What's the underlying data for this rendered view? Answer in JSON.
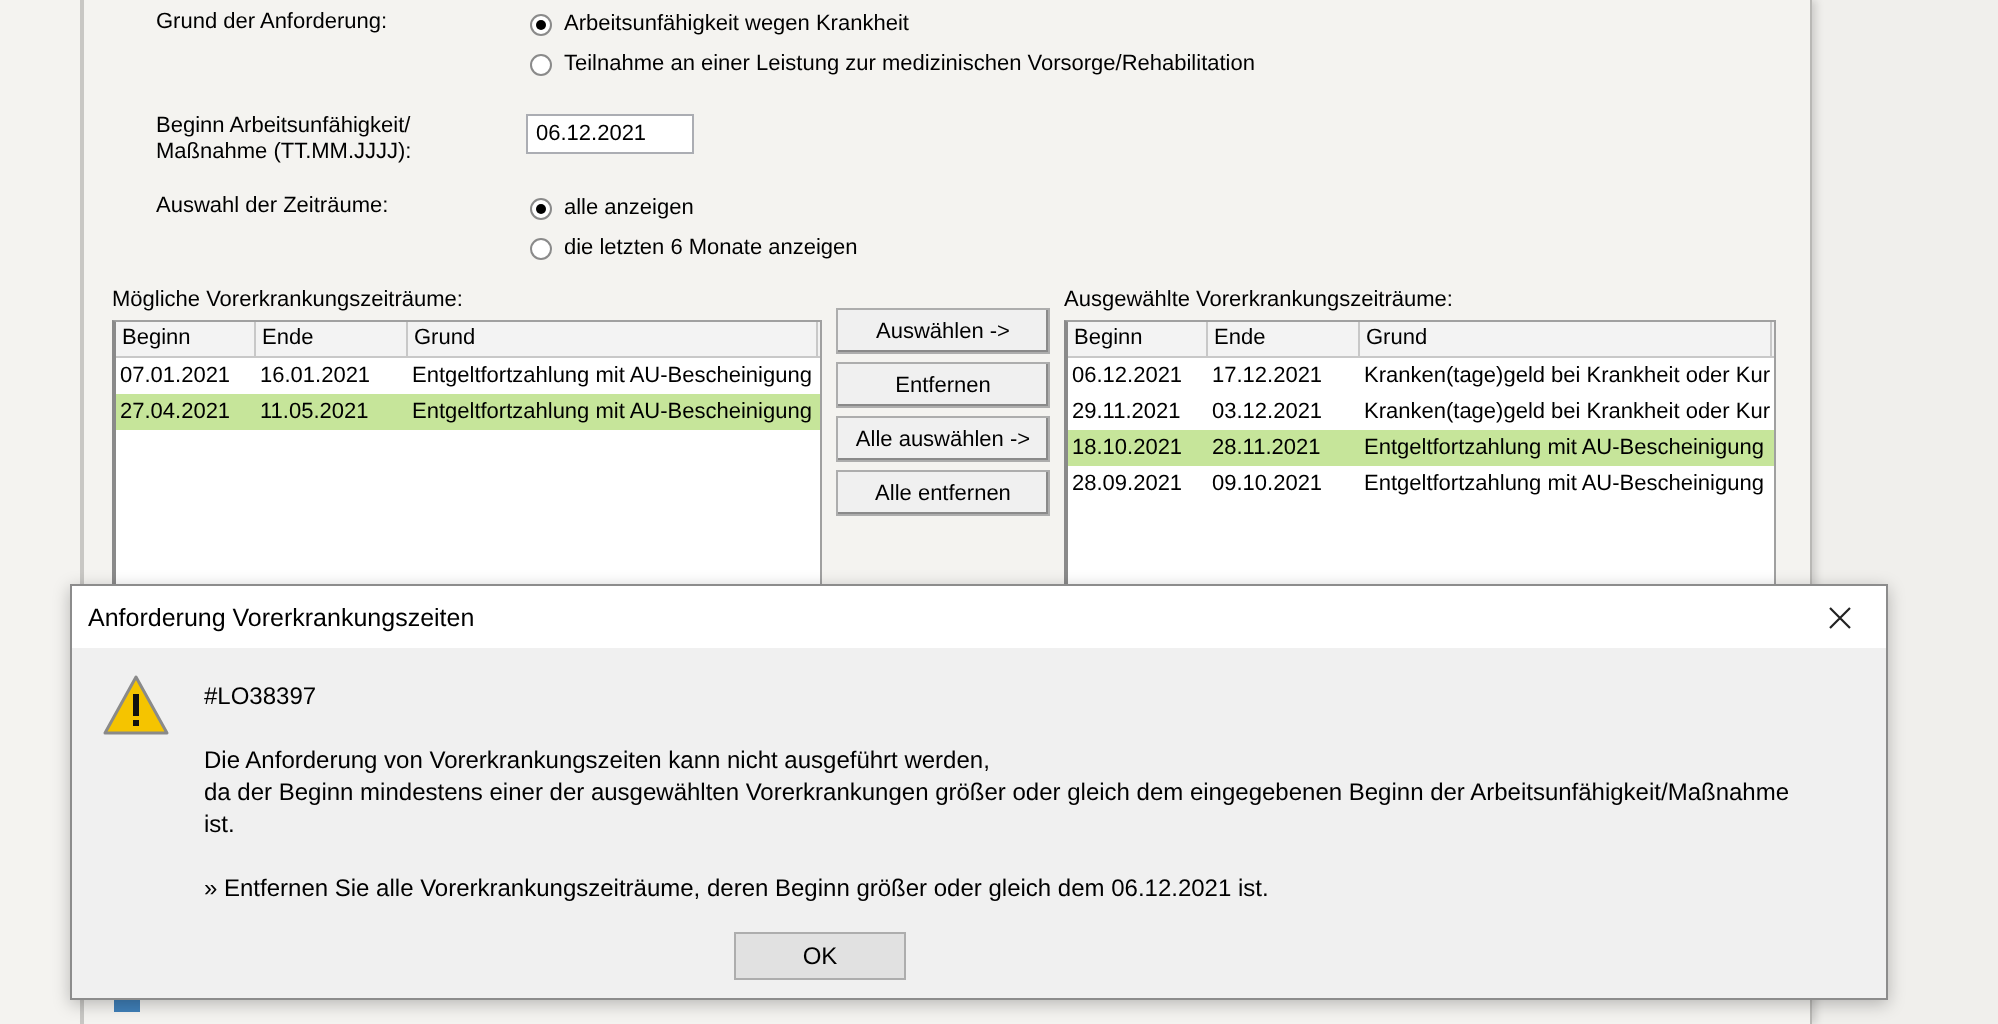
{
  "form": {
    "reason": {
      "label": "Grund der Anforderung:",
      "options": [
        {
          "label": "Arbeitsunfähigkeit wegen Krankheit",
          "selected": true
        },
        {
          "label": "Teilnahme an einer Leistung zur medizinischen Vorsorge/Rehabilitation",
          "selected": false
        }
      ]
    },
    "start": {
      "label_lines": [
        "Beginn Arbeitsunfähigkeit/",
        "Maßnahme (TT.MM.JJJJ):"
      ],
      "value": "06.12.2021"
    },
    "range": {
      "label": "Auswahl der Zeiträume:",
      "options": [
        {
          "label": "alle anzeigen",
          "selected": true
        },
        {
          "label": "die letzten 6 Monate anzeigen",
          "selected": false
        }
      ]
    }
  },
  "possible": {
    "title": "Mögliche Vorerkrankungszeiträume:",
    "columns": [
      "Beginn",
      "Ende",
      "Grund"
    ],
    "rows": [
      {
        "cells": [
          "07.01.2021",
          "16.01.2021",
          "Entgeltfortzahlung mit AU-Bescheinigung"
        ],
        "selected": false
      },
      {
        "cells": [
          "27.04.2021",
          "11.05.2021",
          "Entgeltfortzahlung mit AU-Bescheinigung"
        ],
        "selected": true
      }
    ]
  },
  "buttons": [
    "Auswählen ->",
    "Entfernen",
    "Alle auswählen ->",
    "Alle entfernen"
  ],
  "chosen": {
    "title": "Ausgewählte Vorerkrankungszeiträume:",
    "columns": [
      "Beginn",
      "Ende",
      "Grund"
    ],
    "rows": [
      {
        "cells": [
          "06.12.2021",
          "17.12.2021",
          "Kranken(tage)geld bei Krankheit oder Kur"
        ],
        "selected": false
      },
      {
        "cells": [
          "29.11.2021",
          "03.12.2021",
          "Kranken(tage)geld bei Krankheit oder Kur"
        ],
        "selected": false
      },
      {
        "cells": [
          "18.10.2021",
          "28.11.2021",
          "Entgeltfortzahlung mit AU-Bescheinigung"
        ],
        "selected": true
      },
      {
        "cells": [
          "28.09.2021",
          "09.10.2021",
          "Entgeltfortzahlung mit AU-Bescheinigung"
        ],
        "selected": false
      }
    ]
  },
  "dialog": {
    "title": "Anforderung Vorerkrankungszeiten",
    "code": "#LO38397",
    "message_lines": [
      "Die Anforderung von Vorerkrankungszeiten kann nicht ausgeführt werden,",
      "da der Beginn mindestens einer der ausgewählten Vorerkrankungen größer oder gleich dem eingegebenen Beginn der Arbeitsunfähigkeit/Maßnahme",
      "ist."
    ],
    "hint": "» Entfernen Sie alle Vorerkrankungszeiträume, deren Beginn größer oder gleich dem 06.12.2021 ist.",
    "button": "OK"
  }
}
